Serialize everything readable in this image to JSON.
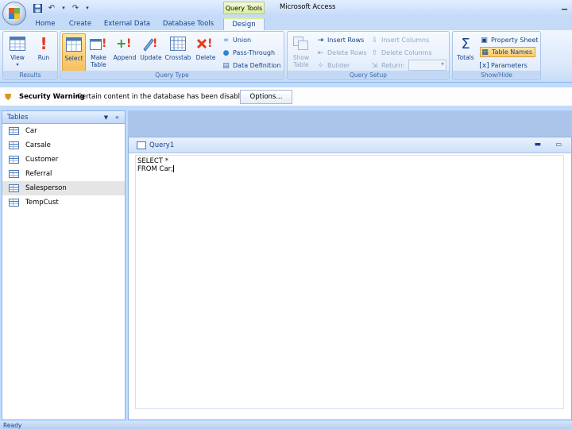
{
  "title_bar": {
    "context_tab": "Query Tools",
    "app_title": "Microsoft Access",
    "qat": [
      "save-icon",
      "undo-icon",
      "redo-icon",
      "customize-icon"
    ]
  },
  "tabs": [
    {
      "label": "Home"
    },
    {
      "label": "Create"
    },
    {
      "label": "External Data"
    },
    {
      "label": "Database Tools"
    },
    {
      "label": "Design",
      "active": true
    }
  ],
  "ribbon": {
    "results": {
      "label": "Results",
      "view": "View",
      "run": "Run"
    },
    "query_type": {
      "label": "Query Type",
      "select": "Select",
      "make_table": "Make Table",
      "append": "Append",
      "update": "Update",
      "crosstab": "Crosstab",
      "delete": "Delete",
      "union": "Union",
      "pass_through": "Pass-Through",
      "data_definition": "Data Definition"
    },
    "query_setup": {
      "label": "Query Setup",
      "show_table": "Show Table",
      "insert_rows": "Insert Rows",
      "delete_rows": "Delete Rows",
      "builder": "Builder",
      "insert_columns": "Insert Columns",
      "delete_columns": "Delete Columns",
      "return": "Return:"
    },
    "show_hide": {
      "label": "Show/Hide",
      "totals": "Totals",
      "property_sheet": "Property Sheet",
      "table_names": "Table Names",
      "parameters": "Parameters"
    }
  },
  "security": {
    "title": "Security Warning",
    "message": "Certain content in the database has been disabled",
    "options": "Options..."
  },
  "nav": {
    "header": "Tables",
    "items": [
      {
        "label": "Car"
      },
      {
        "label": "Carsale"
      },
      {
        "label": "Customer"
      },
      {
        "label": "Referral"
      },
      {
        "label": "Salesperson",
        "selected": true
      },
      {
        "label": "TempCust"
      }
    ]
  },
  "query": {
    "title": "Query1",
    "sql_line1": "SELECT *",
    "sql_line2": "FROM Car;"
  },
  "status": {
    "text": "Ready"
  },
  "colors": {
    "accent": "#15428b",
    "ribbon_bg": "#dde9f9",
    "selected_button": "#f8bf5d"
  }
}
